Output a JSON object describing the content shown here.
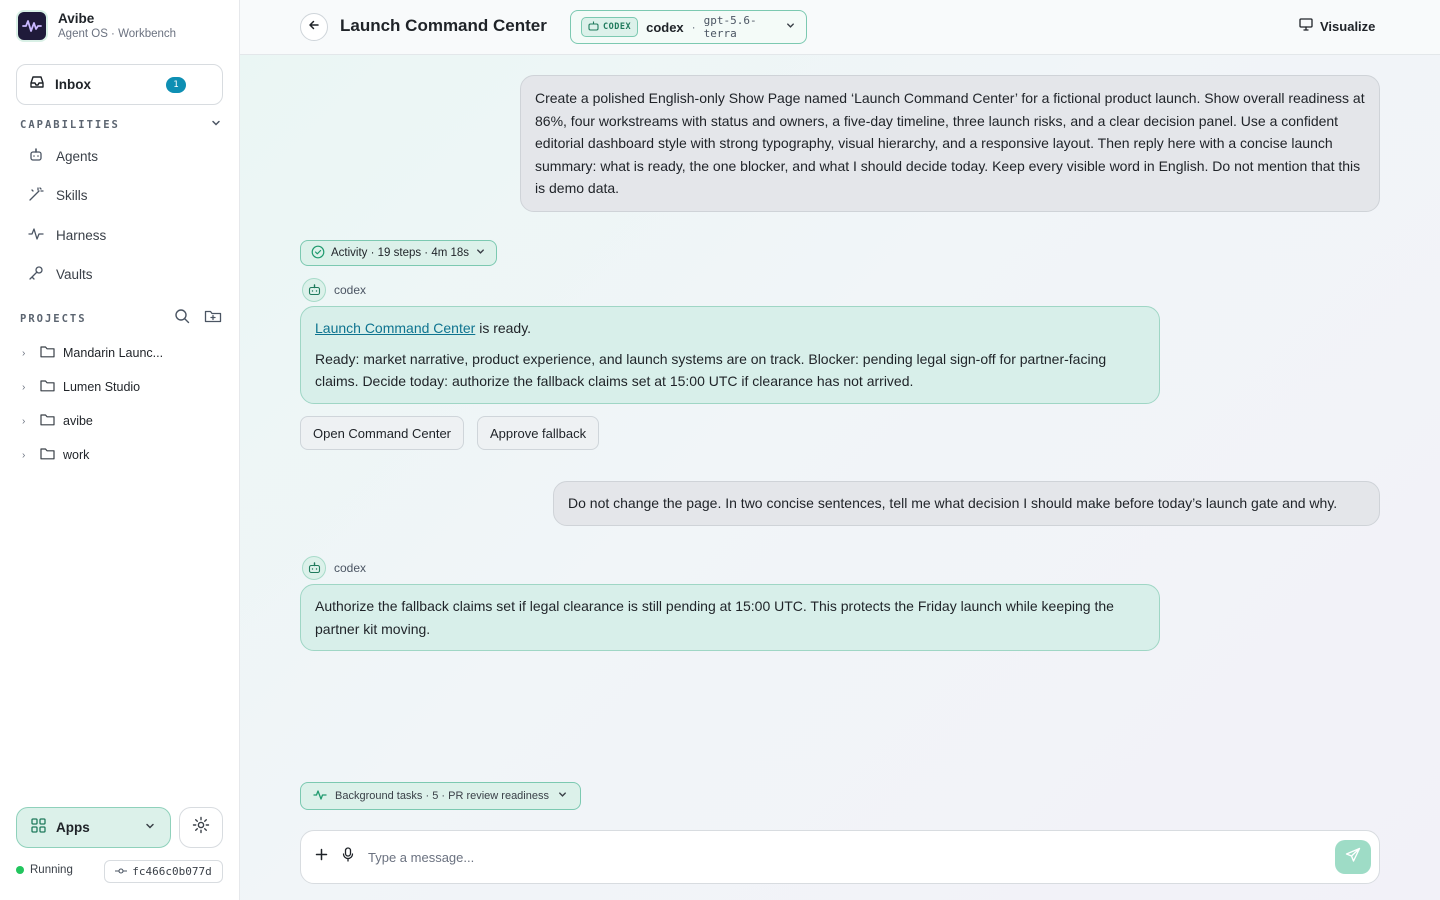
{
  "brand": {
    "name": "Avibe",
    "subtitle": "Agent OS · Workbench"
  },
  "inbox": {
    "label": "Inbox",
    "count": "1"
  },
  "capabilities": {
    "heading": "CAPABILITIES",
    "items": [
      {
        "label": "Agents",
        "icon": "bot-icon"
      },
      {
        "label": "Skills",
        "icon": "wand-icon"
      },
      {
        "label": "Harness",
        "icon": "pulse-icon"
      },
      {
        "label": "Vaults",
        "icon": "key-icon"
      }
    ]
  },
  "projects": {
    "heading": "PROJECTS",
    "items": [
      {
        "label": "Mandarin Launc..."
      },
      {
        "label": "Lumen Studio"
      },
      {
        "label": "avibe"
      },
      {
        "label": "work"
      }
    ]
  },
  "footer": {
    "apps_label": "Apps",
    "status": "Running",
    "commit": "fc466c0b077d"
  },
  "header": {
    "title": "Launch Command Center",
    "model_tag": "CODEX",
    "model_name": "codex",
    "model_sep": "·",
    "model_version": "gpt-5.6-terra",
    "visualize": "Visualize"
  },
  "conversation": {
    "user_msg_1": "Create a polished English-only Show Page named ‘Launch Command Center’ for a fictional product launch. Show overall readiness at 86%, four workstreams with status and owners, a five-day timeline, three launch risks, and a clear decision panel. Use a confident editorial dashboard style with strong typography, visual hierarchy, and a responsive layout. Then reply here with a concise launch summary: what is ready, the one blocker, and what I should decide today. Keep every visible word in English. Do not mention that this is demo data.",
    "activity": "Activity · 19 steps · 4m 18s",
    "agent_name": "codex",
    "agent_msg_1_link": "Launch Command Center",
    "agent_msg_1_suffix": " is ready.",
    "agent_msg_1_body": "Ready: market narrative, product experience, and launch systems are on track. Blocker: pending legal sign-off for partner-facing claims. Decide today: authorize the fallback claims set at 15:00 UTC if clearance has not arrived.",
    "action_1": "Open Command Center",
    "action_2": "Approve fallback",
    "user_msg_2": "Do not change the page. In two concise sentences, tell me what decision I should make before today’s launch gate and why.",
    "agent_msg_2": "Authorize the fallback claims set if legal clearance is still pending at 15:00 UTC. This protects the Friday launch while keeping the partner kit moving."
  },
  "background_tasks": "Background tasks · 5 · PR review readiness",
  "composer": {
    "placeholder": "Type a message..."
  },
  "colors": {
    "accent": "#7cc9b1",
    "accent_bg": "#dcf1ea",
    "badge": "#0e8fb3",
    "link": "#0e7490",
    "status_dot": "#22c55e"
  }
}
